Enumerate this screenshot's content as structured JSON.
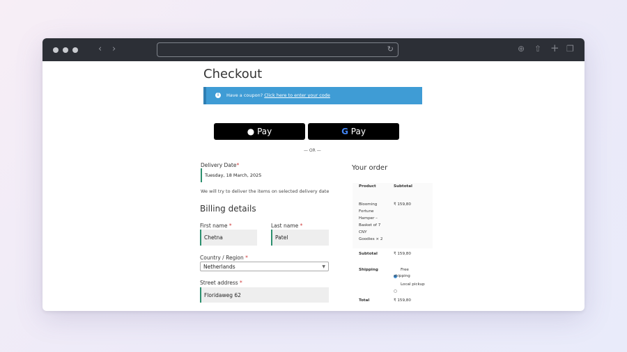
{
  "browser": {
    "url": "",
    "icons": {
      "back": "chevron-left-icon",
      "forward": "chevron-right-icon",
      "reload": "reload-icon",
      "download": "download-icon",
      "share": "share-icon",
      "new_tab": "plus-icon",
      "tabs": "tabs-icon"
    }
  },
  "page": {
    "title": "Checkout",
    "coupon": {
      "text": "Have a coupon?",
      "link": "Click here to enter your code"
    },
    "payment": {
      "apple_pay_label": "Pay",
      "google_pay_g": "G",
      "google_pay_label": "Pay",
      "or_divider": "— OR —"
    },
    "delivery": {
      "label": "Delivery Date",
      "required_mark": "*",
      "value": "Tuesday, 18 March, 2025",
      "note": "We will try to deliver the items on selected delivery date"
    },
    "billing": {
      "heading": "Billing details",
      "first_name_label": "First name",
      "first_name_value": "Chetna",
      "last_name_label": "Last name",
      "last_name_value": "Patel",
      "country_label": "Country / Region",
      "country_value": "Netherlands",
      "street_label": "Street address",
      "street_value": "Floridaweg 62",
      "required_mark": "*"
    },
    "order": {
      "heading": "Your order",
      "col_product": "Product",
      "col_subtotal": "Subtotal",
      "item_name_lines": [
        "Blooming",
        "Fortune",
        "Hamper –",
        "Basket of 7",
        "CNY",
        "Goodies"
      ],
      "item_qty": "× 2",
      "item_subtotal": "₹ 159,80",
      "subtotal_label": "Subtotal",
      "subtotal_value": "₹ 159,80",
      "shipping_label": "Shipping",
      "shipping_free_line1": "Free",
      "shipping_free_line2": "shipping",
      "shipping_local": "Local pickup",
      "total_label": "Total",
      "total_value": "₹ 159,80"
    }
  },
  "colors": {
    "accent_blue": "#3f9cd5",
    "field_border": "#2c8f6e",
    "required": "#d03a3a"
  }
}
